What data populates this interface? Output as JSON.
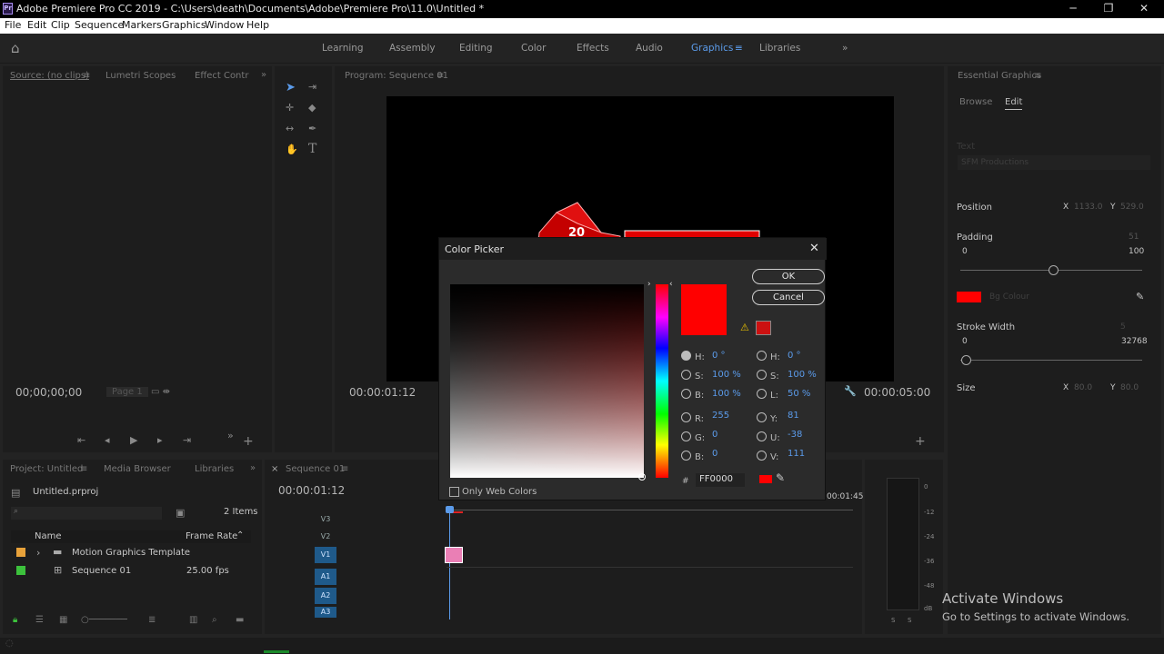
{
  "window": {
    "title": "Adobe Premiere Pro CC 2019 - C:\\Users\\death\\Documents\\Adobe\\Premiere Pro\\11.0\\Untitled *",
    "app_badge": "Pr"
  },
  "menu": [
    "File",
    "Edit",
    "Clip",
    "Sequence",
    "Markers",
    "Graphics",
    "Window",
    "Help"
  ],
  "workspaces": [
    "Learning",
    "Assembly",
    "Editing",
    "Color",
    "Effects",
    "Audio",
    "Graphics",
    "Libraries"
  ],
  "active_workspace": "Graphics",
  "source_panel": {
    "tabs": [
      "Source: (no clips)",
      "Lumetri Scopes",
      "Effect Contr"
    ],
    "timecode": "00;00;00;00",
    "page": "Page 1"
  },
  "program_panel": {
    "tab": "Program: Sequence 01",
    "timecode": "00:00:01:12",
    "duration": "00:00:05:00",
    "graphic_number": "20"
  },
  "essential_graphics": {
    "tab": "Essential Graphics",
    "subtabs": [
      "Browse",
      "Edit"
    ],
    "text_label": "Text",
    "text_value": "SFM Productions",
    "position_label": "Position",
    "pos_x_label": "X",
    "pos_x": "1133.0",
    "pos_y_label": "Y",
    "pos_y": "529.0",
    "padding_label": "Padding",
    "padding_value": "51",
    "padding_min": "0",
    "padding_max": "100",
    "bg_label": "Bg Colour",
    "bg_color": "#ff0000",
    "stroke_label": "Stroke Width",
    "stroke_value": "5",
    "stroke_min": "0",
    "stroke_max": "32768",
    "size_label": "Size",
    "size_x_label": "X",
    "size_x": "80.0",
    "size_y_label": "Y",
    "size_y": "80.0"
  },
  "color_picker": {
    "title": "Color Picker",
    "ok": "OK",
    "cancel": "Cancel",
    "current_color": "#ff0000",
    "out_of_gamut_color": "#cc1111",
    "hsb": [
      {
        "label": "H:",
        "value": "0 °"
      },
      {
        "label": "S:",
        "value": "100 %"
      },
      {
        "label": "B:",
        "value": "100 %"
      }
    ],
    "rgb": [
      {
        "label": "R:",
        "value": "255"
      },
      {
        "label": "G:",
        "value": "0"
      },
      {
        "label": "B:",
        "value": "0"
      }
    ],
    "hsl": [
      {
        "label": "H:",
        "value": "0 °"
      },
      {
        "label": "S:",
        "value": "100 %"
      },
      {
        "label": "L:",
        "value": "50 %"
      }
    ],
    "yuv": [
      {
        "label": "Y:",
        "value": "81"
      },
      {
        "label": "U:",
        "value": "-38"
      },
      {
        "label": "V:",
        "value": "111"
      }
    ],
    "hash": "#",
    "hex": "FF0000",
    "web_only_label": "Only Web Colors"
  },
  "project_panel": {
    "tabs": [
      "Project: Untitled",
      "Media Browser",
      "Libraries"
    ],
    "file": "Untitled.prproj",
    "items_count": "2 Items",
    "col_name": "Name",
    "col_rate": "Frame Rate",
    "rows": [
      {
        "name": "Motion Graphics Template",
        "rate": "",
        "color": "#e8a23a"
      },
      {
        "name": "Sequence 01",
        "rate": "25.00 fps",
        "color": "#3cc13c"
      }
    ]
  },
  "timeline": {
    "tab": "Sequence 01",
    "timecode": "00:00:01:12",
    "ruler_end": "00:01:45",
    "tracks": [
      "V3",
      "V2",
      "V1",
      "A1",
      "A2",
      "A3"
    ],
    "selected_track": "V1"
  },
  "meter": {
    "db": [
      "0",
      "-12",
      "-24",
      "-36",
      "-48",
      "dB"
    ],
    "solo": [
      "S",
      "S"
    ]
  },
  "watermark": {
    "line1": "Activate Windows",
    "line2": "Go to Settings to activate Windows."
  }
}
